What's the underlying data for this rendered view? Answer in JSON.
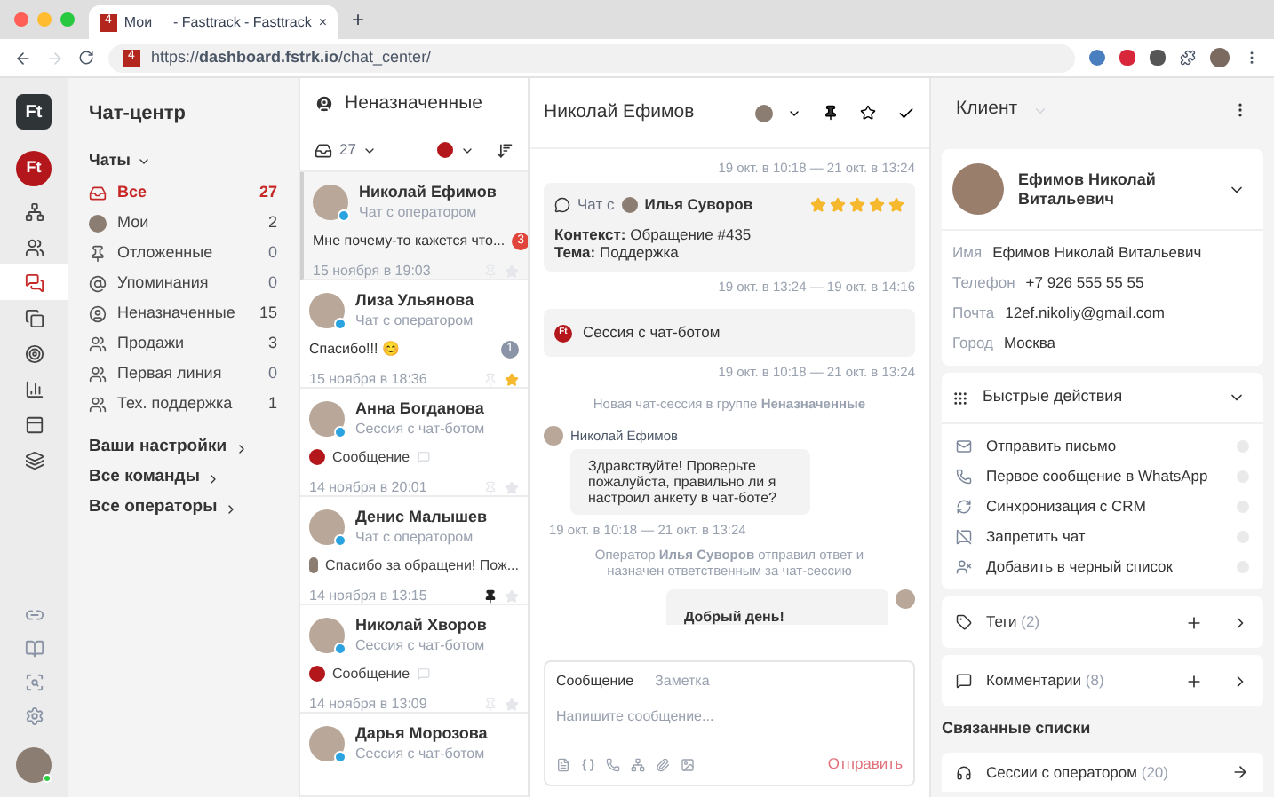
{
  "browser": {
    "tab_badge": "4",
    "tab_title": "Мои",
    "tab_suffix": "- Fasttrack - Fasttrack",
    "close": "×",
    "new_tab": "+",
    "url_badge": "4",
    "url": "https://**dashboard.fstrk.io**/chat_center/"
  },
  "rail": {
    "logo": "Ft",
    "account": "Ft",
    "items": [
      {
        "kind": "tree",
        "selected": false
      },
      {
        "kind": "contacts",
        "selected": false
      },
      {
        "kind": "chat",
        "selected": true
      },
      {
        "kind": "copy",
        "selected": false
      },
      {
        "kind": "target",
        "selected": false
      },
      {
        "kind": "chart",
        "selected": false
      },
      {
        "kind": "calendar",
        "selected": false
      },
      {
        "kind": "layers",
        "selected": false
      }
    ],
    "bottom_items": [
      {
        "kind": "link"
      },
      {
        "kind": "book"
      },
      {
        "kind": "search"
      },
      {
        "kind": "settings"
      }
    ],
    "user_online": true
  },
  "sidebar": {
    "title": "Чат-центр",
    "group": "Чаты",
    "items": [
      {
        "kind": "inbox",
        "label": "Все",
        "count": "27",
        "selected": true
      },
      {
        "kind": "avatar",
        "label": "Мои",
        "count": "2",
        "selected": false
      },
      {
        "kind": "pin",
        "label": "Отложенные",
        "count": "0",
        "selected": false
      },
      {
        "kind": "mention",
        "label": "Упоминания",
        "count": "0",
        "selected": false
      },
      {
        "kind": "user",
        "label": "Неназначенные",
        "count": "15",
        "selected": false
      },
      {
        "kind": "team",
        "label": "Продажи",
        "count": "3",
        "selected": false
      },
      {
        "kind": "team",
        "label": "Первая линия",
        "count": "0",
        "selected": false
      },
      {
        "kind": "team",
        "label": "Тех. поддержка",
        "count": "1",
        "selected": false
      }
    ],
    "links": [
      "Ваши настройки",
      "Все команды",
      "Все операторы"
    ]
  },
  "list": {
    "title": "Неназначенные",
    "count": "27",
    "conversations": [
      {
        "name": "Николай Ефимов",
        "channel": "Чат с оператором",
        "kind": "text",
        "message": "Мне почему-то кажется что...",
        "unread": "3",
        "color": "#e0453b",
        "time": "15 ноября в 19:03",
        "pinned": false,
        "starred": false,
        "selected": true
      },
      {
        "name": "Лиза Ульянова",
        "channel": "Чат с оператором",
        "kind": "text",
        "message": "Спасибо!!! 😊",
        "unread": "1",
        "color": "#8a94a6",
        "time": "15 ноября в 18:36",
        "pinned": false,
        "starred": true,
        "selected": false
      },
      {
        "name": "Анна Богданова",
        "channel": "Сессия с чат-ботом",
        "kind": "bot",
        "message": "Сообщение",
        "time": "14 ноября в 20:01",
        "pinned": false,
        "starred": false,
        "selected": false
      },
      {
        "name": "Денис Малышев",
        "channel": "Чат с оператором",
        "kind": "operator",
        "message": "Спасибо за обращени! Пож...",
        "time": "14 ноября в 13:15",
        "pinned": true,
        "starred": false,
        "selected": false
      },
      {
        "name": "Николай Хворов",
        "channel": "Сессия с чат-ботом",
        "kind": "bot",
        "message": "Сообщение",
        "time": "14 ноября в 13:09",
        "pinned": false,
        "starred": false,
        "selected": false
      },
      {
        "name": "Дарья Морозова",
        "channel": "Сессия с чат-ботом",
        "selected": false
      }
    ]
  },
  "chat": {
    "title": "Николай Ефимов",
    "events": [
      {
        "kind": "time",
        "text": "19 окт. в 10:18 — 21 окт. в 13:24"
      },
      {
        "kind": "operator_card",
        "label": "Чат с",
        "operator": "Илья Суворов",
        "stars": 5,
        "lines": [
          "**Контекст:** Обращение #435",
          "**Тема:** Поддержка"
        ]
      },
      {
        "kind": "time",
        "text": "19 окт. в 13:24 — 19 окт. в 14:16"
      },
      {
        "kind": "bot_card",
        "badge": "Ft",
        "label": "Сессия с чат-ботом"
      },
      {
        "kind": "time",
        "text": "19 окт. в 10:18 — 21 окт. в 13:24"
      },
      {
        "kind": "system",
        "text": "Новая чат-сессия в группе **Неназначенные**"
      },
      {
        "kind": "incoming",
        "author": "Николай Ефимов",
        "text": "Здравствуйте! Проверьте пожалуйста, правильно ли я настроил анкету в чат-боте?",
        "time": "19 окт. в 10:18 — 21 окт. в 13:24"
      },
      {
        "kind": "system",
        "text": "Оператор **Илья Суворов** отправил ответ и назначен ответственным за чат-сессию"
      },
      {
        "kind": "outgoing",
        "text": "Добрый день!"
      }
    ],
    "composer": {
      "tabs": [
        {
          "label": "Сообщение",
          "selected": true
        },
        {
          "label": "Заметка",
          "selected": false
        }
      ],
      "placeholder": "Напишите сообщение...",
      "send": "Отправить"
    }
  },
  "client": {
    "title": "Клиент",
    "name": "Ефимов Николай Витальевич",
    "fields": [
      {
        "label": "Имя",
        "value": "Ефимов Николай Витальевич"
      },
      {
        "label": "Телефон",
        "value": "+7 926 555 55 55"
      },
      {
        "label": "Почта",
        "value": "12ef.nikoliy@gmail.com"
      },
      {
        "label": "Город",
        "value": "Москва"
      }
    ],
    "quick_title": "Быстрые действия",
    "actions": [
      {
        "kind": "mail",
        "label": "Отправить письмо"
      },
      {
        "kind": "whatsapp",
        "label": "Первое сообщение в WhatsApp"
      },
      {
        "kind": "sync",
        "label": "Синхронизация с CRM"
      },
      {
        "kind": "block",
        "label": "Запретить чат"
      },
      {
        "kind": "blacklist",
        "label": "Добавить в черный список"
      }
    ],
    "sections": [
      {
        "kind": "tags",
        "label": "Теги",
        "count": "(2)"
      },
      {
        "kind": "comments",
        "label": "Комментарии",
        "count": "(8)"
      }
    ],
    "linked_title": "Связанные списки",
    "linked": [
      {
        "label": "Сессии с оператором",
        "count": "(20)"
      }
    ]
  }
}
